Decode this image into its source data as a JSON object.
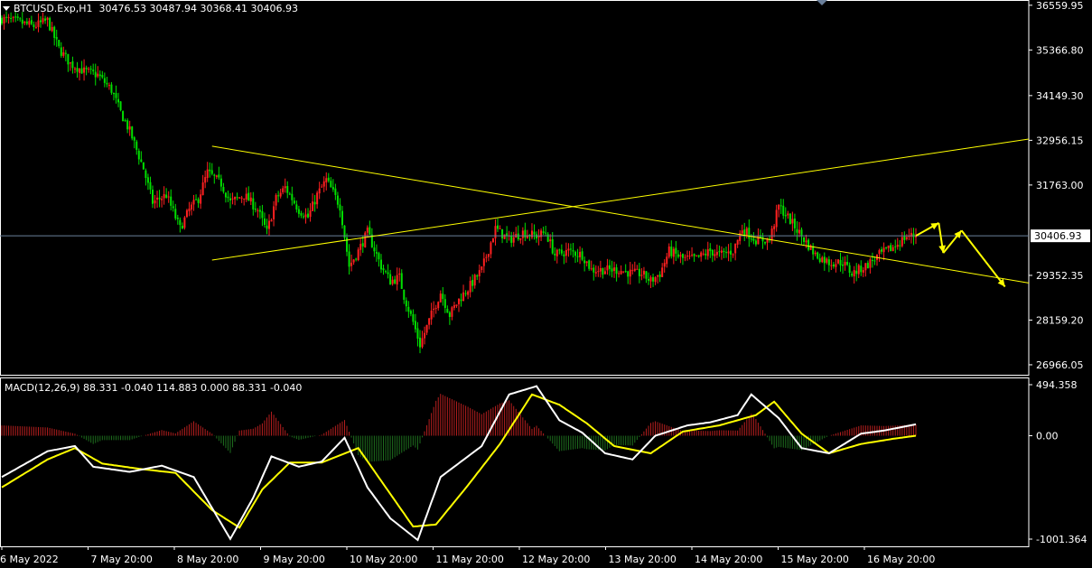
{
  "header": {
    "symbol": "BTCUSD.Exp,H1",
    "ohlc": "30476.53 30487.94 30368.41 30406.93",
    "macd_label": "MACD(12,26,9) 88.331 -0.040 114.883 0.000 88.331 -0.040"
  },
  "price_axis": {
    "ticks": [
      "36559.95",
      "35366.80",
      "34149.30",
      "32956.15",
      "31763.00",
      "29352.35",
      "28159.20",
      "26966.05"
    ],
    "current_price": "30406.93"
  },
  "macd_axis": {
    "ticks": [
      "494.358",
      "0.00",
      "-1001.364"
    ]
  },
  "time_axis": {
    "ticks": [
      "6 May 2022",
      "7 May 20:00",
      "8 May 20:00",
      "9 May 20:00",
      "10 May 20:00",
      "11 May 20:00",
      "12 May 20:00",
      "13 May 20:00",
      "14 May 20:00",
      "15 May 20:00",
      "16 May 20:00"
    ]
  },
  "colors": {
    "background": "#000000",
    "bull": "#ff2020",
    "bear": "#00e000",
    "trendline": "#ffff00",
    "macd_line": "#ffffff",
    "signal_line": "#ffff00",
    "hist_pos": "#b41e1e",
    "hist_neg": "#1e6e1e",
    "price_line": "#6a7f9a",
    "axis": "#ffffff"
  },
  "chart_data": [
    {
      "type": "candlestick",
      "title": "BTCUSD.Exp,H1",
      "ylim": [
        26700,
        36700
      ],
      "close_path": [
        [
          0,
          36200
        ],
        [
          8,
          36100
        ],
        [
          14,
          36000
        ],
        [
          20,
          36150
        ],
        [
          23,
          35700
        ],
        [
          25,
          35400
        ],
        [
          30,
          35000
        ],
        [
          36,
          34800
        ],
        [
          42,
          34700
        ],
        [
          48,
          34300
        ],
        [
          52,
          33700
        ],
        [
          56,
          33200
        ],
        [
          62,
          32200
        ],
        [
          66,
          31300
        ],
        [
          72,
          31500
        ],
        [
          78,
          30600
        ],
        [
          82,
          31100
        ],
        [
          86,
          31400
        ],
        [
          90,
          32100
        ],
        [
          96,
          31800
        ],
        [
          100,
          31300
        ],
        [
          106,
          31500
        ],
        [
          112,
          31100
        ],
        [
          116,
          30500
        ],
        [
          120,
          31400
        ],
        [
          124,
          31700
        ],
        [
          130,
          31100
        ],
        [
          134,
          30900
        ],
        [
          138,
          31500
        ],
        [
          142,
          31900
        ],
        [
          148,
          31200
        ],
        [
          152,
          29600
        ],
        [
          156,
          30000
        ],
        [
          160,
          30500
        ],
        [
          166,
          29600
        ],
        [
          170,
          29200
        ],
        [
          174,
          29300
        ],
        [
          176,
          28800
        ],
        [
          180,
          28100
        ],
        [
          183,
          27500
        ],
        [
          188,
          28300
        ],
        [
          192,
          28900
        ],
        [
          196,
          28300
        ],
        [
          200,
          28700
        ],
        [
          204,
          29000
        ],
        [
          210,
          29500
        ],
        [
          216,
          30600
        ],
        [
          222,
          30300
        ],
        [
          228,
          30500
        ],
        [
          234,
          30400
        ],
        [
          238,
          30500
        ],
        [
          242,
          29900
        ],
        [
          248,
          30000
        ],
        [
          254,
          29900
        ],
        [
          258,
          29500
        ],
        [
          264,
          29500
        ],
        [
          270,
          29500
        ],
        [
          276,
          29400
        ],
        [
          280,
          29400
        ],
        [
          284,
          29200
        ],
        [
          288,
          29400
        ],
        [
          292,
          30000
        ],
        [
          298,
          29800
        ],
        [
          304,
          29800
        ],
        [
          310,
          30000
        ],
        [
          314,
          29900
        ],
        [
          320,
          30000
        ],
        [
          324,
          30600
        ],
        [
          330,
          30300
        ],
        [
          336,
          30300
        ],
        [
          340,
          31200
        ],
        [
          344,
          30900
        ],
        [
          350,
          30400
        ],
        [
          356,
          29900
        ],
        [
          362,
          29700
        ],
        [
          368,
          29700
        ],
        [
          372,
          29400
        ],
        [
          378,
          29600
        ],
        [
          384,
          29900
        ],
        [
          390,
          30100
        ],
        [
          396,
          30400
        ],
        [
          400,
          30407
        ]
      ],
      "trendlines": [
        {
          "start": [
            92,
            32800
          ],
          "end": [
            503,
            29150
          ]
        },
        {
          "start": [
            92,
            29760
          ],
          "end": [
            503,
            32990
          ]
        }
      ],
      "forecast_path": [
        [
          400,
          30407
        ],
        [
          410,
          30750
        ],
        [
          412,
          29950
        ],
        [
          420,
          30550
        ],
        [
          439,
          29050
        ]
      ]
    },
    {
      "type": "line",
      "title": "MACD(12,26,9) 88.331 -0.040 114.883 0.000 88.331 -0.040",
      "ylim": [
        -1001.364,
        494.358
      ],
      "series": [
        {
          "values": [
            [
              0,
              -400
            ],
            [
              20,
              -150
            ],
            [
              32,
              -100
            ],
            [
              40,
              -300
            ],
            [
              56,
              -350
            ],
            [
              70,
              -290
            ],
            [
              84,
              -400
            ],
            [
              100,
              -1000
            ],
            [
              110,
              -600
            ],
            [
              118,
              -200
            ],
            [
              130,
              -300
            ],
            [
              140,
              -250
            ],
            [
              150,
              -20
            ],
            [
              160,
              -500
            ],
            [
              170,
              -800
            ],
            [
              182,
              -1010
            ],
            [
              192,
              -400
            ],
            [
              210,
              -100
            ],
            [
              222,
              400
            ],
            [
              234,
              480
            ],
            [
              244,
              150
            ],
            [
              254,
              30
            ],
            [
              264,
              -170
            ],
            [
              276,
              -230
            ],
            [
              286,
              0
            ],
            [
              300,
              100
            ],
            [
              310,
              130
            ],
            [
              322,
              200
            ],
            [
              328,
              400
            ],
            [
              340,
              170
            ],
            [
              350,
              -120
            ],
            [
              362,
              -170
            ],
            [
              376,
              20
            ],
            [
              386,
              50
            ],
            [
              400,
              110
            ]
          ]
        },
        {
          "values": [
            [
              0,
              -500
            ],
            [
              20,
              -230
            ],
            [
              32,
              -120
            ],
            [
              44,
              -270
            ],
            [
              60,
              -320
            ],
            [
              76,
              -360
            ],
            [
              92,
              -720
            ],
            [
              104,
              -890
            ],
            [
              114,
              -520
            ],
            [
              126,
              -260
            ],
            [
              140,
              -260
            ],
            [
              156,
              -120
            ],
            [
              168,
              -500
            ],
            [
              180,
              -880
            ],
            [
              190,
              -860
            ],
            [
              204,
              -480
            ],
            [
              218,
              -80
            ],
            [
              232,
              400
            ],
            [
              244,
              300
            ],
            [
              256,
              120
            ],
            [
              268,
              -100
            ],
            [
              284,
              -170
            ],
            [
              298,
              40
            ],
            [
              314,
              100
            ],
            [
              330,
              200
            ],
            [
              338,
              330
            ],
            [
              350,
              20
            ],
            [
              362,
              -170
            ],
            [
              376,
              -80
            ],
            [
              390,
              -30
            ],
            [
              400,
              0
            ]
          ]
        }
      ]
    }
  ]
}
